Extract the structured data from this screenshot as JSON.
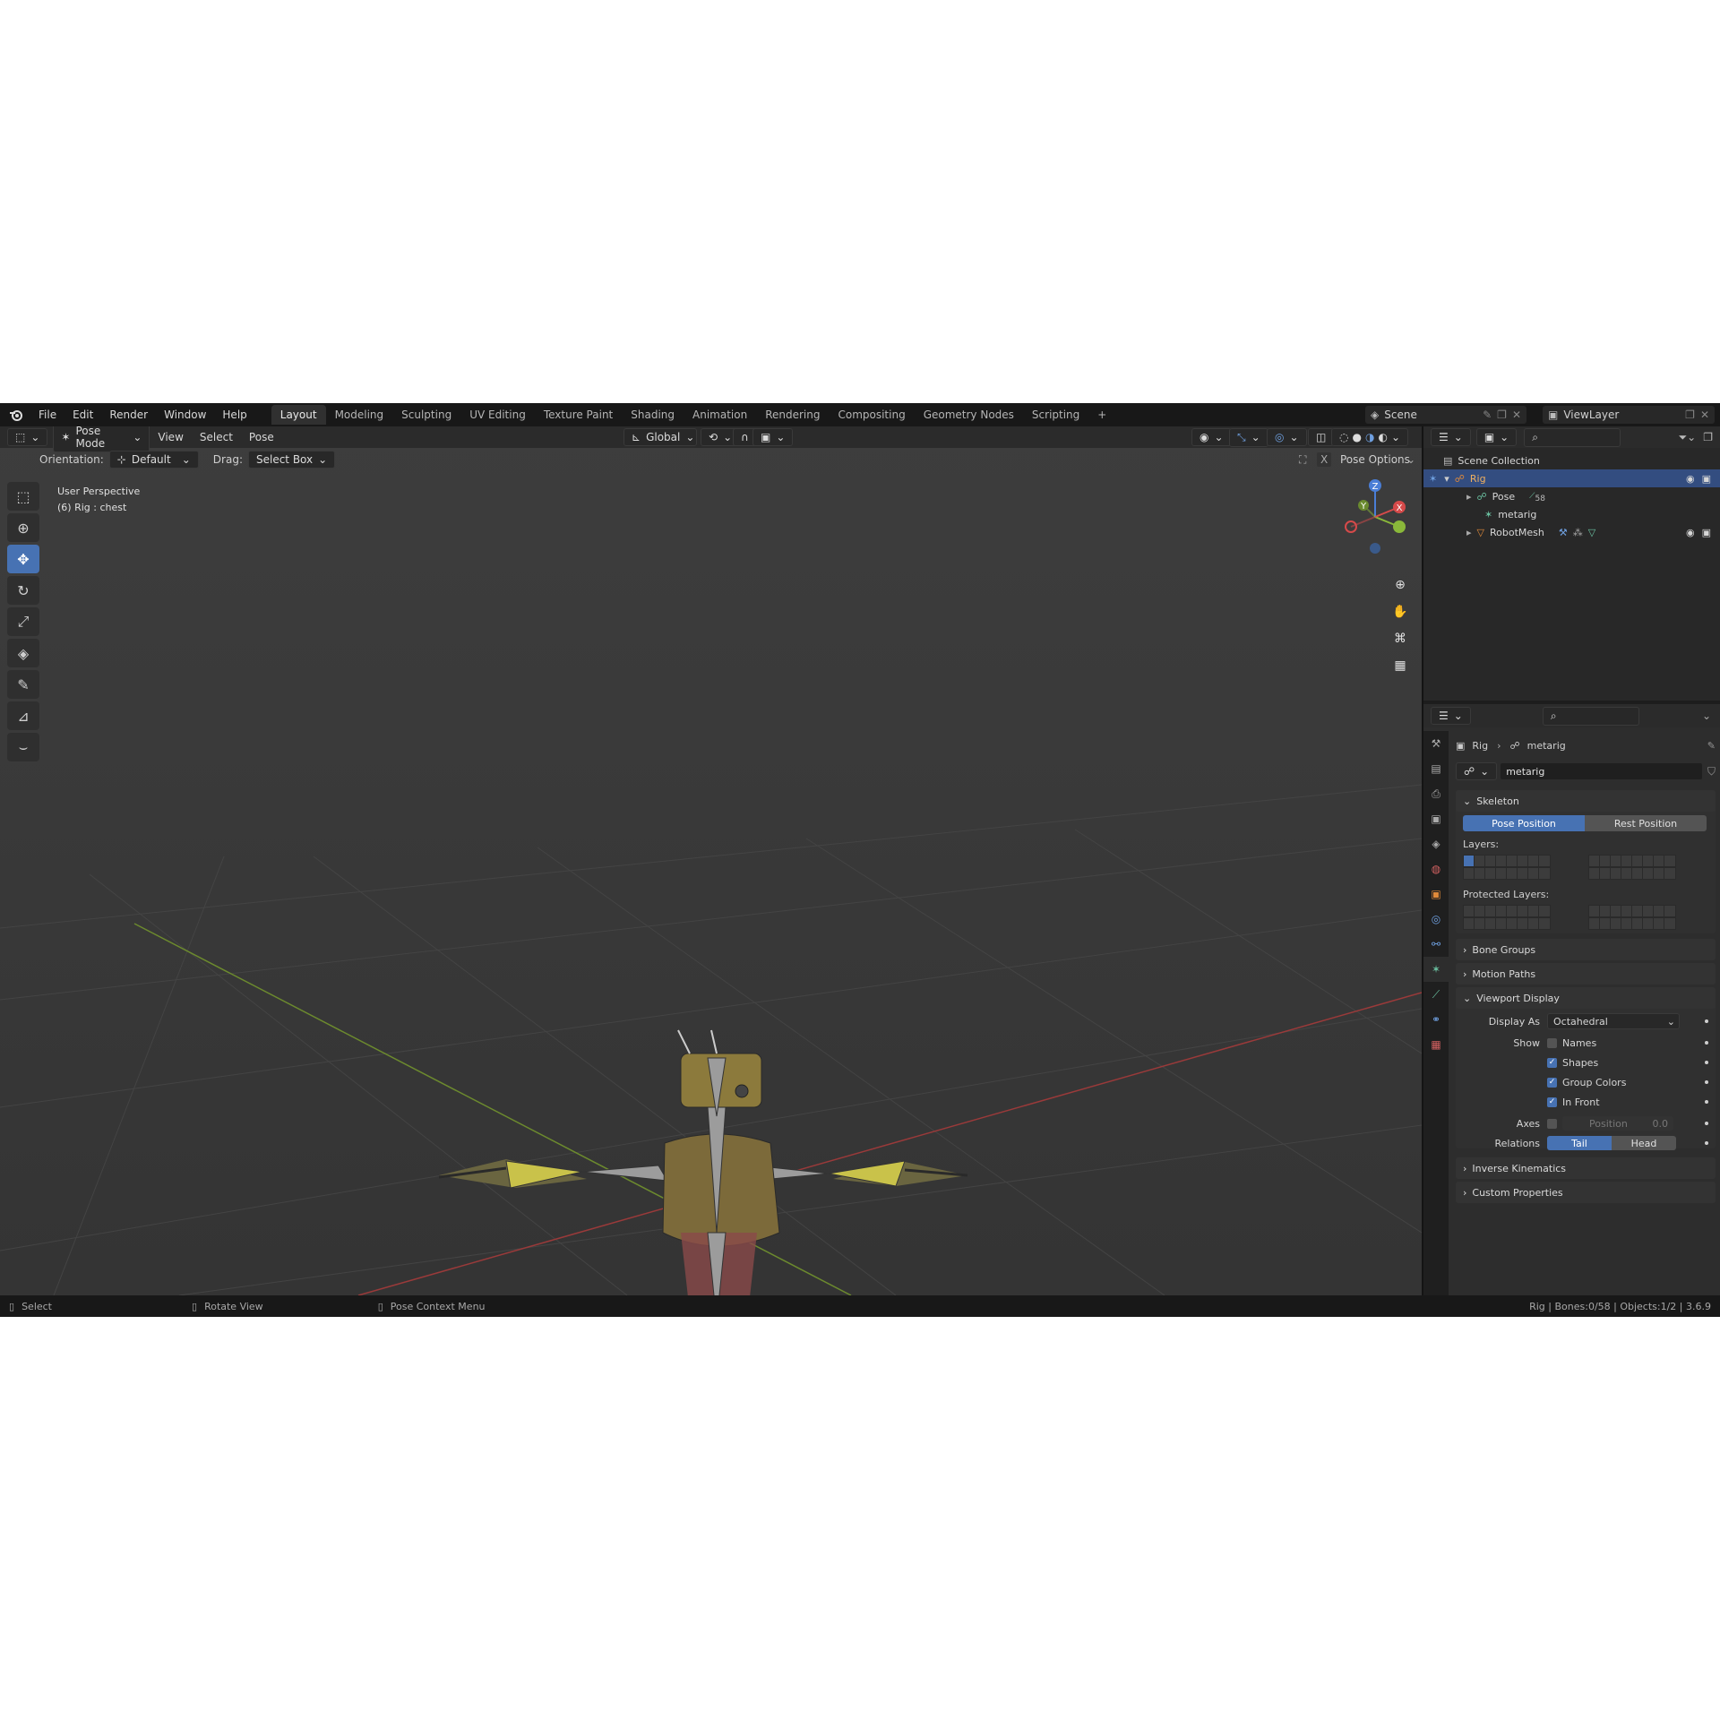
{
  "menu": [
    "File",
    "Edit",
    "Render",
    "Window",
    "Help"
  ],
  "workspaces": [
    "Layout",
    "Modeling",
    "Sculpting",
    "UV Editing",
    "Texture Paint",
    "Shading",
    "Animation",
    "Rendering",
    "Compositing",
    "Geometry Nodes",
    "Scripting"
  ],
  "add_tab": "+",
  "scene": "Scene",
  "view_layer": "ViewLayer",
  "viewport": {
    "mode": "Pose Mode",
    "menus": [
      "View",
      "Select",
      "Pose"
    ],
    "transform": "Global",
    "orientation_label": "Orientation:",
    "orientation": "Default",
    "drag_label": "Drag:",
    "drag": "Select Box",
    "pose_options": "Pose Options",
    "x_label": "X",
    "overlay_line1": "User Perspective",
    "overlay_line2": "(6) Rig : chest",
    "gizmo": {
      "z": "Z",
      "y": "Y",
      "x": "X"
    }
  },
  "outliner": {
    "collection": "Scene Collection",
    "rows": [
      {
        "label": "Rig"
      },
      {
        "label": "Pose",
        "badge": "58"
      },
      {
        "label": "metarig"
      },
      {
        "label": "RobotMesh"
      }
    ]
  },
  "properties": {
    "breadcrumb_obj": "Rig",
    "breadcrumb_data": "metarig",
    "datablock": "metarig",
    "skeleton": {
      "title": "Skeleton",
      "pose_position": "Pose Position",
      "rest_position": "Rest Position",
      "layers_label": "Layers:",
      "protected_label": "Protected Layers:"
    },
    "bone_groups": "Bone Groups",
    "motion_paths": "Motion Paths",
    "viewport_display": {
      "title": "Viewport Display",
      "display_as_label": "Display As",
      "display_as": "Octahedral",
      "show_label": "Show",
      "names": "Names",
      "names_checked": false,
      "shapes": "Shapes",
      "shapes_checked": true,
      "group_colors": "Group Colors",
      "group_colors_checked": true,
      "in_front": "In Front",
      "in_front_checked": true,
      "axes_label": "Axes",
      "position_label": "Position",
      "position_value": "0.0",
      "relations_label": "Relations",
      "tail": "Tail",
      "head": "Head"
    },
    "inverse_kinematics": "Inverse Kinematics",
    "custom_properties": "Custom Properties"
  },
  "status": {
    "select": "Select",
    "rotate": "Rotate View",
    "context": "Pose Context Menu",
    "info": "Rig | Bones:0/58 | Objects:1/2 | 3.6.9"
  },
  "colors": {
    "accent": "#4772b3",
    "active_tab": "#303030",
    "bone_yellow": "#c9c24a",
    "bone_gray": "#9c9c9c"
  }
}
